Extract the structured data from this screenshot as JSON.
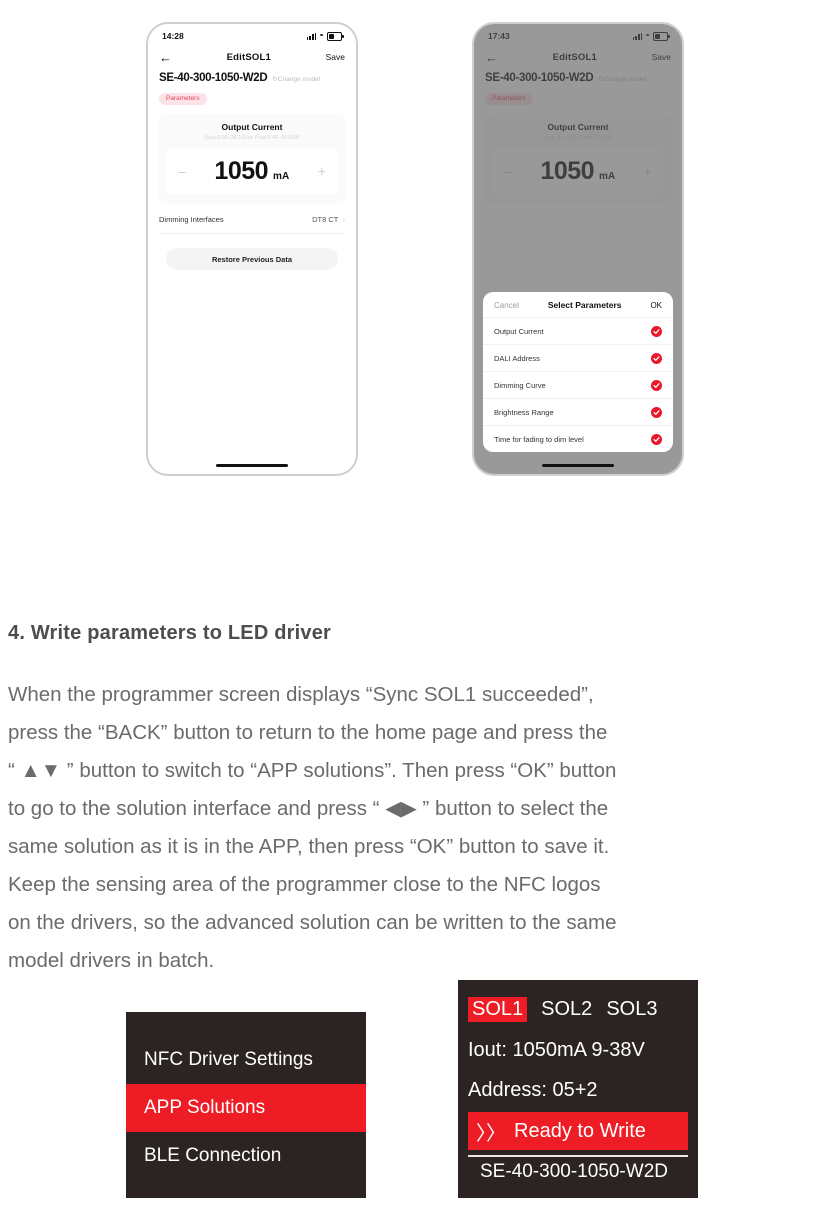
{
  "phone_1": {
    "status": {
      "time": "14:28",
      "signal_icon": "signal-bars-icon",
      "wifi_icon": "wifi-icon",
      "battery_icon": "battery-icon"
    },
    "nav": {
      "back_icon": "back-arrow-icon",
      "title": "EditSOL1",
      "save_label": "Save"
    },
    "model_name": "SE-40-300-1050-W2D",
    "change_model_label": "Change model",
    "tag_label": "Parameters",
    "card": {
      "title": "Output Current",
      "subtitle": "Uout:9.00–38.10Vdc  Pout:9.45–40.00W",
      "minus_label": "–",
      "plus_label": "+",
      "value": "1050",
      "unit": "mA"
    },
    "dimming_row": {
      "label": "Dimming Interfaces",
      "value": "DT8 CT",
      "chevron_icon": "chevron-right-icon"
    },
    "restore_label": "Restore Previous Data"
  },
  "phone_2": {
    "status": {
      "time": "17:43",
      "signal_icon": "signal-bars-icon",
      "wifi_icon": "wifi-icon",
      "battery_icon": "battery-icon"
    },
    "nav": {
      "back_icon": "back-arrow-icon",
      "title": "EditSOL1",
      "save_label": "Save"
    },
    "model_name": "SE-40-300-1050-W2D",
    "change_model_label": "Change model",
    "tag_label": "Parameters",
    "card": {
      "title": "Output Current",
      "subtitle": "Uout: 9~42Vdc   Pout: 27-40W",
      "minus_label": "–",
      "plus_label": "+",
      "value": "1050",
      "unit": "mA"
    },
    "sheet": {
      "cancel_label": "Cancel",
      "title": "Select Parameters",
      "ok_label": "OK",
      "rows": [
        {
          "label": "Output Current",
          "checked": true
        },
        {
          "label": "DALI Address",
          "checked": true
        },
        {
          "label": "Dimming Curve",
          "checked": true
        },
        {
          "label": "Brightness Range",
          "checked": true
        },
        {
          "label": "Time for fading to dim level",
          "checked": true
        }
      ]
    }
  },
  "document": {
    "heading": "4.  Write parameters to LED driver",
    "paragraph_lines": [
      "When the programmer screen displays “Sync SOL1 succeeded”,",
      "press the “BACK” button to return to the home page and press the",
      "“ ▲▼ ” button to switch to “APP solutions”. Then press “OK” button",
      "to go to the solution interface and press “ ◀▶ ” button to select the",
      "same solution as it is in the APP, then press “OK” button to save it.",
      "Keep the sensing area of the programmer close to the NFC logos",
      "on the drivers, so the advanced solution can be written to the same",
      "model drivers in batch."
    ]
  },
  "lcd_left": {
    "items": [
      {
        "label": "NFC Driver Settings",
        "highlighted": false
      },
      {
        "label": "APP Solutions",
        "highlighted": true
      },
      {
        "label": "BLE Connection",
        "highlighted": false
      }
    ]
  },
  "lcd_right": {
    "solutions": [
      {
        "label": "SOL1",
        "active": true
      },
      {
        "label": "SOL2",
        "active": false
      },
      {
        "label": "SOL3",
        "active": false
      }
    ],
    "iout_line": "Iout: 1050mA  9-38V",
    "address_line": "Address: 05+2",
    "status_arrow": "〉〉",
    "status_label": "Ready to Write",
    "model_line": "SE-40-300-1050-W2D"
  },
  "colors": {
    "accent_red": "#ee1c25",
    "lcd_bg": "#2b2422",
    "tag_bg": "#fbe3e7",
    "tag_text": "#e8455e"
  }
}
